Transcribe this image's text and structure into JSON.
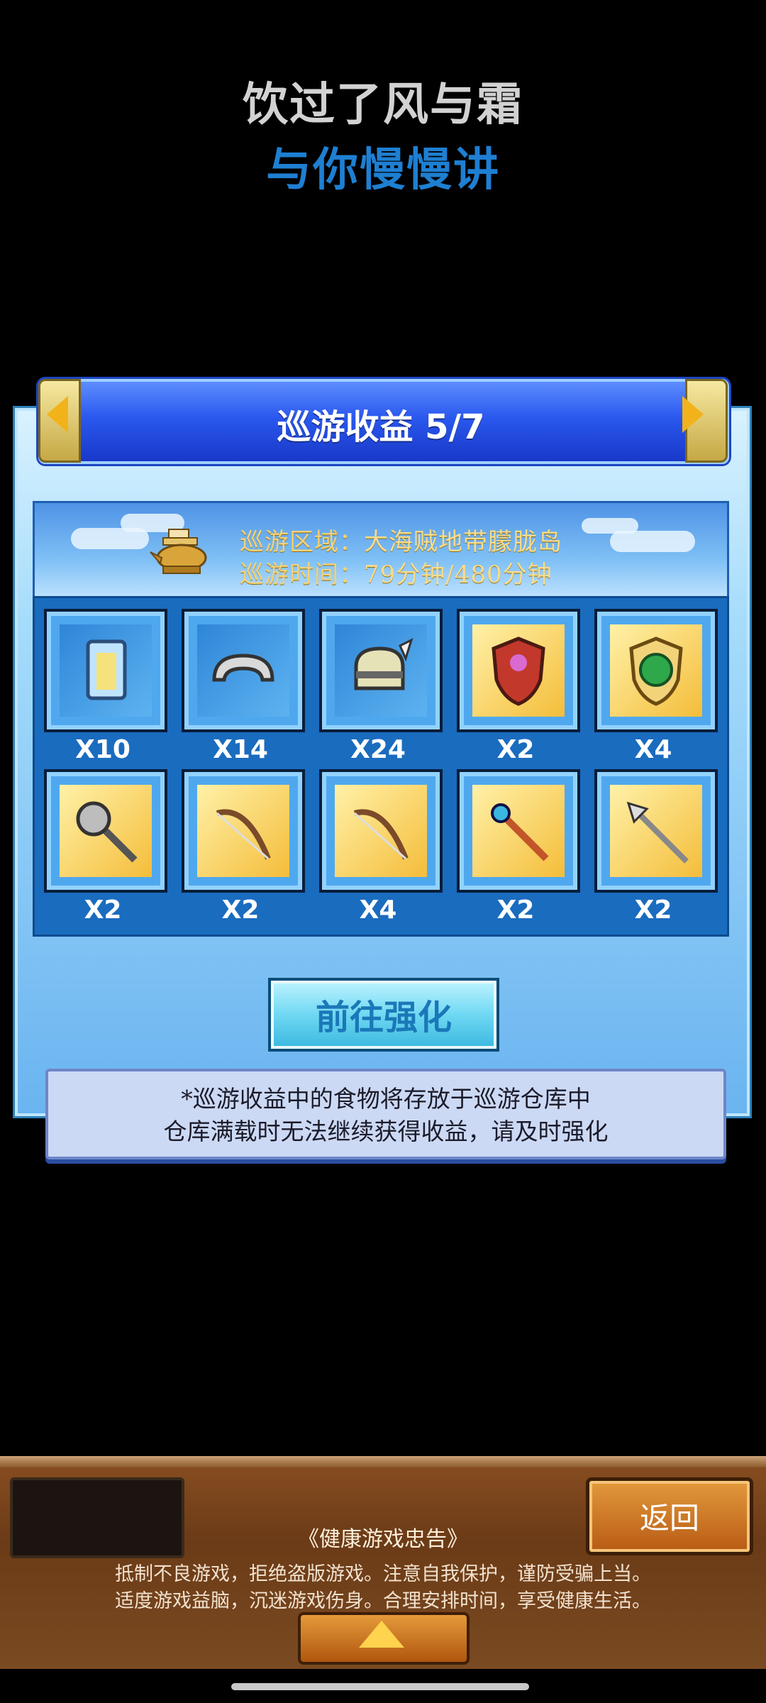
{
  "slogan": {
    "line1": "饮过了风与霜",
    "line2": "与你慢慢讲"
  },
  "panel": {
    "title": "巡游收益 5/7",
    "info": {
      "region_label": "巡游区域：",
      "region_value": "大海贼地带朦胧岛",
      "time_label": "巡游时间：",
      "time_value": "79分钟/480分钟"
    },
    "items": [
      {
        "icon": "scroll-icon",
        "qty": "X10"
      },
      {
        "icon": "headband-icon",
        "qty": "X14"
      },
      {
        "icon": "helmet-icon",
        "qty": "X24"
      },
      {
        "icon": "red-shield-icon",
        "qty": "X2"
      },
      {
        "icon": "green-shield-icon",
        "qty": "X4"
      },
      {
        "icon": "mace-icon",
        "qty": "X2"
      },
      {
        "icon": "bow-icon",
        "qty": "X2"
      },
      {
        "icon": "bow-icon",
        "qty": "X4"
      },
      {
        "icon": "staff-icon",
        "qty": "X2"
      },
      {
        "icon": "spear-icon",
        "qty": "X2"
      }
    ],
    "enhance_label": "前往强化",
    "notice_line1": "*巡游收益中的食物将存放于巡游仓库中",
    "notice_line2": "仓库满载时无法继续获得收益，请及时强化"
  },
  "footer": {
    "back_label": "返回",
    "advisory_title": "《健康游戏忠告》",
    "advisory_line1": "抵制不良游戏，拒绝盗版游戏。注意自我保护，谨防受骗上当。",
    "advisory_line2": "适度游戏益脑，沉迷游戏伤身。合理安排时间，享受健康生活。",
    "up_icon": "up-arrow-icon"
  },
  "colors": {
    "gold": "#f2b21a",
    "banner_blue": "#2a58ee",
    "panel_blue": "#1a6cbf"
  }
}
